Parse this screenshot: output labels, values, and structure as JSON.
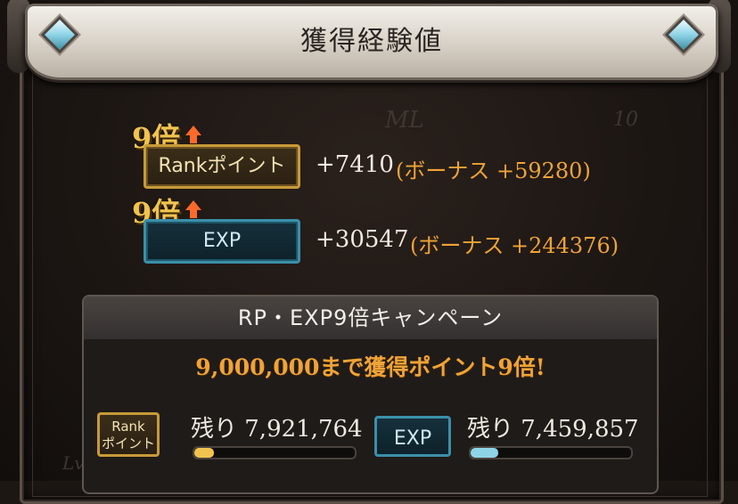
{
  "title": "獲得経験値",
  "rows": [
    {
      "multiplier": "9倍",
      "badge": "Rankポイント",
      "gain": "+7410",
      "bonus": "(ボーナス +59280)",
      "accent": "#c79a38"
    },
    {
      "multiplier": "9倍",
      "badge": "EXP",
      "gain": "+30547",
      "bonus": "(ボーナス +244376)",
      "accent": "#3b8faa"
    }
  ],
  "campaign": {
    "header": "RP・EXP9倍キャンペーン",
    "subtitle": "9,000,000まで獲得ポイント9倍!",
    "rank": {
      "badge_line1": "Rank",
      "badge_line2": "ポイント",
      "remaining": "残り 7,921,764",
      "progress": 0.12,
      "bar_color": "#f0c34f"
    },
    "exp": {
      "badge": "EXP",
      "remaining": "残り 7,459,857",
      "progress": 0.17,
      "bar_color": "#8fd3e6"
    }
  },
  "background": {
    "watermark_ml": "ML",
    "watermark_num": "10",
    "watermark_lv": "Lv"
  },
  "icons": [
    "gem-icon",
    "up-arrow-icon"
  ]
}
